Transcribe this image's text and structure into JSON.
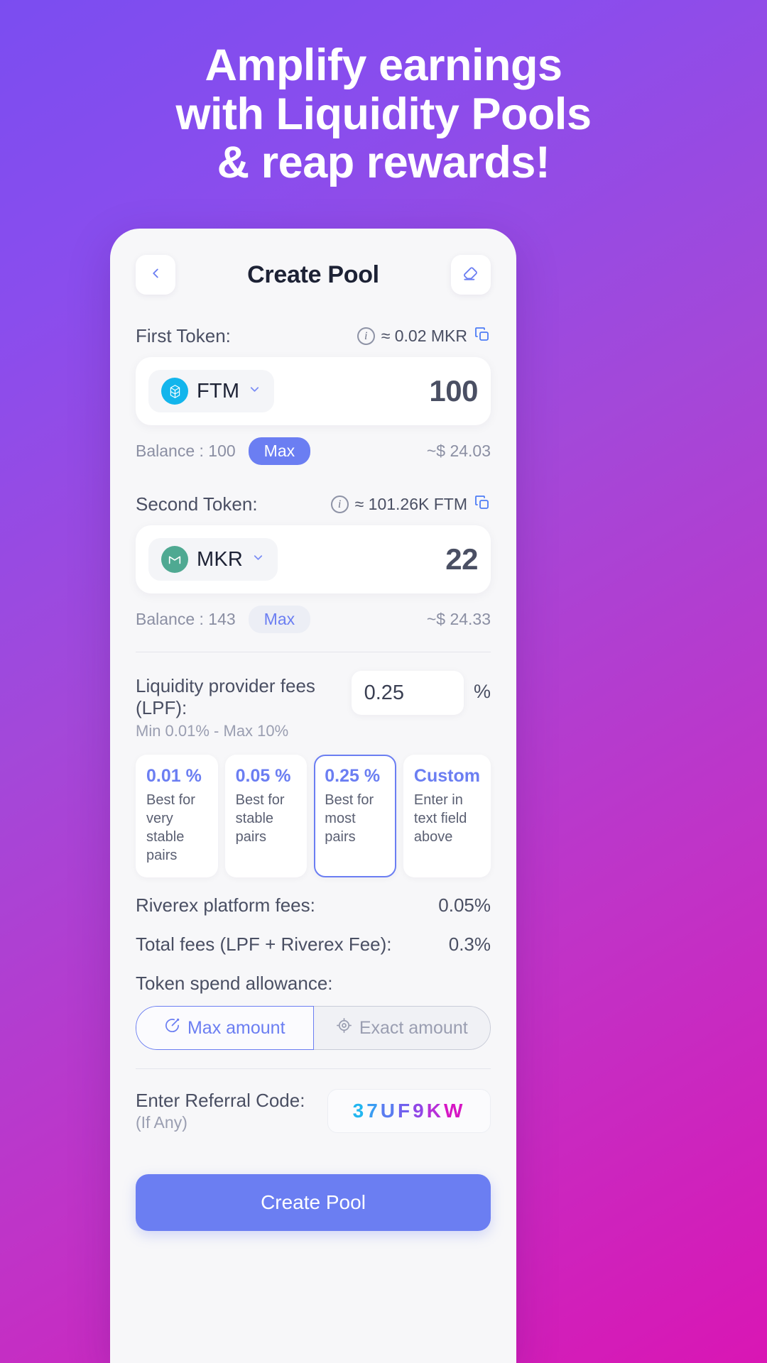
{
  "hero": {
    "line1": "Amplify earnings",
    "line2": "with Liquidity Pools",
    "line3": "& reap rewards!"
  },
  "appbar": {
    "title": "Create Pool",
    "back_icon": "chevron-left-icon",
    "clear_icon": "eraser-icon"
  },
  "first_token": {
    "label": "First Token:",
    "info_icon": "i",
    "approx": "≈ 0.02 MKR",
    "copy_icon": "copy-icon",
    "symbol": "FTM",
    "amount": "100",
    "balance": "Balance : 100",
    "max_label": "Max",
    "usd": "~$ 24.03"
  },
  "second_token": {
    "label": "Second Token:",
    "info_icon": "i",
    "approx": "≈ 101.26K FTM",
    "copy_icon": "copy-icon",
    "symbol": "MKR",
    "amount": "22",
    "balance": "Balance : 143",
    "max_label": "Max",
    "usd": "~$ 24.33"
  },
  "lpf": {
    "title": "Liquidity provider fees (LPF):",
    "subtitle": "Min 0.01% - Max 10%",
    "value": "0.25",
    "placeholder": "0.25",
    "unit": "%",
    "presets": [
      {
        "value": "0.01 %",
        "desc": "Best for very stable pairs",
        "selected": false
      },
      {
        "value": "0.05 %",
        "desc": "Best for stable pairs",
        "selected": false
      },
      {
        "value": "0.25 %",
        "desc": "Best for most pairs",
        "selected": true
      },
      {
        "value": "Custom",
        "desc": "Enter in text field above",
        "selected": false
      }
    ]
  },
  "summary": {
    "platform_label": "Riverex platform fees:",
    "platform_value": "0.05%",
    "total_label": "Total fees (LPF + Riverex Fee):",
    "total_value": "0.3%"
  },
  "allowance": {
    "label": "Token spend allowance:",
    "max_option": "Max amount",
    "max_icon": "pie-chart-icon",
    "exact_option": "Exact amount",
    "exact_icon": "target-icon"
  },
  "referral": {
    "label": "Enter Referral Code:",
    "sublabel": "(If Any)",
    "code": "37UF9KW",
    "code_chars": [
      "3",
      "7",
      "U",
      "F",
      "9",
      "K",
      "W"
    ]
  },
  "cta": {
    "label": "Create Pool"
  },
  "colors": {
    "accent": "#6b7ef2",
    "bg_start": "#7b4df0",
    "bg_end": "#d916b4",
    "ftm": "#13b5ec",
    "mkr": "#4fa992"
  }
}
